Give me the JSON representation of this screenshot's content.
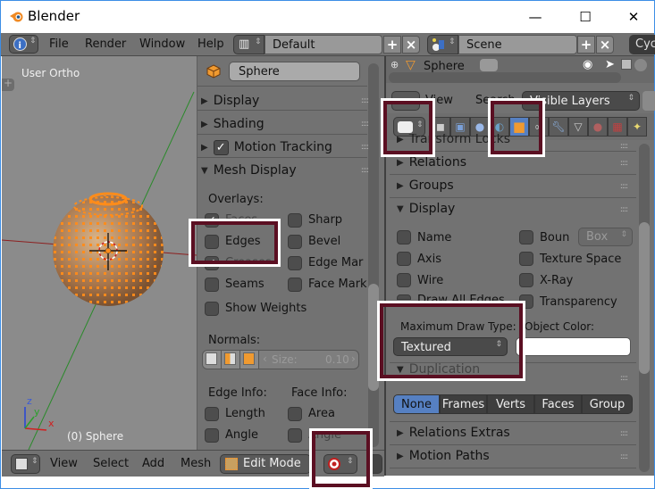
{
  "window": {
    "title": "Blender",
    "controls": {
      "minimize": "—",
      "maximize": "☐",
      "close": "✕"
    }
  },
  "topbar": {
    "menus": [
      "File",
      "Render",
      "Window",
      "Help"
    ],
    "layout_field": "Default",
    "scene_field": "Scene",
    "engine_partial": "Cyc"
  },
  "viewport": {
    "view_label": "User Ortho",
    "object_label": "(0) Sphere",
    "axis_labels": {
      "x": "x",
      "y": "y",
      "z": "z"
    }
  },
  "mid_panel": {
    "object_name": "Sphere",
    "sections": [
      {
        "label": "Display",
        "expanded": false
      },
      {
        "label": "Shading",
        "expanded": false
      },
      {
        "label": "Motion Tracking",
        "expanded": false,
        "checked": true
      },
      {
        "label": "Mesh Display",
        "expanded": true
      }
    ],
    "overlays_label": "Overlays:",
    "overlays_left": [
      {
        "label": "Faces",
        "checked": true
      },
      {
        "label": "Edges",
        "checked": false
      },
      {
        "label": "Creases",
        "checked": true
      },
      {
        "label": "Seams",
        "checked": false
      },
      {
        "label": "Show Weights",
        "checked": false
      }
    ],
    "overlays_right": [
      {
        "label": "Sharp",
        "checked": false
      },
      {
        "label": "Bevel",
        "checked": false
      },
      {
        "label": "Edge Mar",
        "checked": false
      },
      {
        "label": "Face Mark",
        "checked": false
      }
    ],
    "normals_label": "Normals:",
    "normals_size_label": "Size:",
    "normals_size_value": "0.10",
    "edge_info_label": "Edge Info:",
    "face_info_label": "Face Info:",
    "edge_info": [
      {
        "label": "Length",
        "checked": false
      },
      {
        "label": "Angle",
        "checked": false
      }
    ],
    "face_info": [
      {
        "label": "Area",
        "checked": false
      },
      {
        "label": "Angle",
        "checked": false
      }
    ]
  },
  "bottombar": {
    "menus": [
      "View",
      "Select",
      "Add",
      "Mesh"
    ],
    "mode": "Edit Mode"
  },
  "right_panel": {
    "outliner_item": "Sphere",
    "header_menus": [
      "View",
      "Search"
    ],
    "layers_dropdown": "Visible Layers",
    "collapsed_top": "Transform Locks",
    "sections_before": [
      "Relations",
      "Groups"
    ],
    "display_section": "Display",
    "display_left": [
      {
        "label": "Name",
        "checked": false
      },
      {
        "label": "Axis",
        "checked": false
      },
      {
        "label": "Wire",
        "checked": false
      },
      {
        "label": "Draw All Edges",
        "checked": false
      }
    ],
    "display_right": [
      {
        "label": "Boun",
        "checked": false
      },
      {
        "label": "Texture Space",
        "checked": false
      },
      {
        "label": "X-Ray",
        "checked": false
      },
      {
        "label": "Transparency",
        "checked": false
      }
    ],
    "bounds_type": "Box",
    "max_draw_type_label": "Maximum Draw Type:",
    "max_draw_type_value": "Textured",
    "object_color_label": "Object Color:",
    "object_color": "#ffffff",
    "duplication_label": "Duplication",
    "duplication_options": [
      "None",
      "Frames",
      "Verts",
      "Faces",
      "Group"
    ],
    "duplication_selected": "None",
    "sections_after": [
      "Relations Extras",
      "Motion Paths"
    ]
  },
  "colors": {
    "highlight_border": "#5b0f22",
    "accent_blue": "#5680c2",
    "selection_orange": "#ff8c1a"
  }
}
